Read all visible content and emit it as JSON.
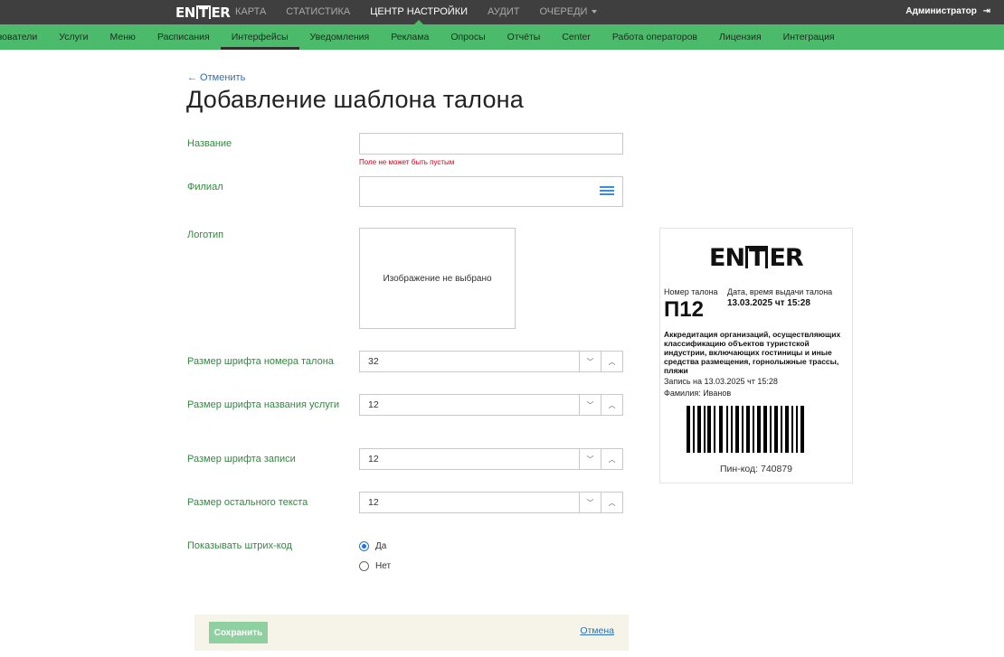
{
  "topbar": {
    "logo": "ENTER",
    "nav": [
      {
        "label": "КАРТА"
      },
      {
        "label": "СТАТИСТИКА"
      },
      {
        "label": "ЦЕНТР НАСТРОЙКИ",
        "active": true
      },
      {
        "label": "АУДИТ"
      },
      {
        "label": "ОЧЕРЕДИ"
      }
    ],
    "user": "Администратор"
  },
  "subnav": [
    "ьзователи",
    "Услуги",
    "Меню",
    "Расписания",
    "Интерфейсы",
    "Уведомления",
    "Реклама",
    "Опросы",
    "Отчёты",
    "Center",
    "Работа операторов",
    "Лицензия",
    "Интеграция"
  ],
  "subnav_active": "Интерфейсы",
  "form": {
    "back_link": "← Отменить",
    "title": "Добавление шаблона талона",
    "name_label": "Название",
    "name_value": "",
    "name_error": "Поле не может быть пустым",
    "branch_label": "Филиал",
    "logo_label": "Логотип",
    "logo_placeholder": "Изображение не выбрано",
    "ticket_font_label": "Размер шрифта номера талона",
    "ticket_font_value": "32",
    "service_font_label": "Размер шрифта названия услуги",
    "service_font_value": "12",
    "record_font_label": "Размер шрифта записи",
    "record_font_value": "12",
    "other_font_label": "Размер остального текста",
    "other_font_value": "12",
    "barcode_label": "Показывать штрих-код",
    "barcode_yes": "Да",
    "barcode_no": "Нет",
    "barcode_selected": "Да"
  },
  "actions": {
    "save": "Сохранить",
    "cancel": "Отмена"
  },
  "ticket": {
    "logo": "ENTER",
    "number_label": "Номер талона",
    "date_label": "Дата, время выдачи талона",
    "number": "П12",
    "date": "13.03.2025 чт 15:28",
    "service": "Аккредитация организаций, осуществляющих классификацию объектов туристской индустрии, включающих гостиницы и иные средства размещения, горнолыжные трассы, пляжи",
    "record": "Запись на 13.03.2025 чт 15:28",
    "surname": "Фамилия: Иванов",
    "pin": "Пин-код: 740879"
  },
  "colors": {
    "topbar": "#3f3f3f",
    "subnav": "#4cba6b",
    "label": "#2f8a3e",
    "error": "#d0021b",
    "link": "#2f6fb0",
    "save_button": "#8fd0a0"
  }
}
